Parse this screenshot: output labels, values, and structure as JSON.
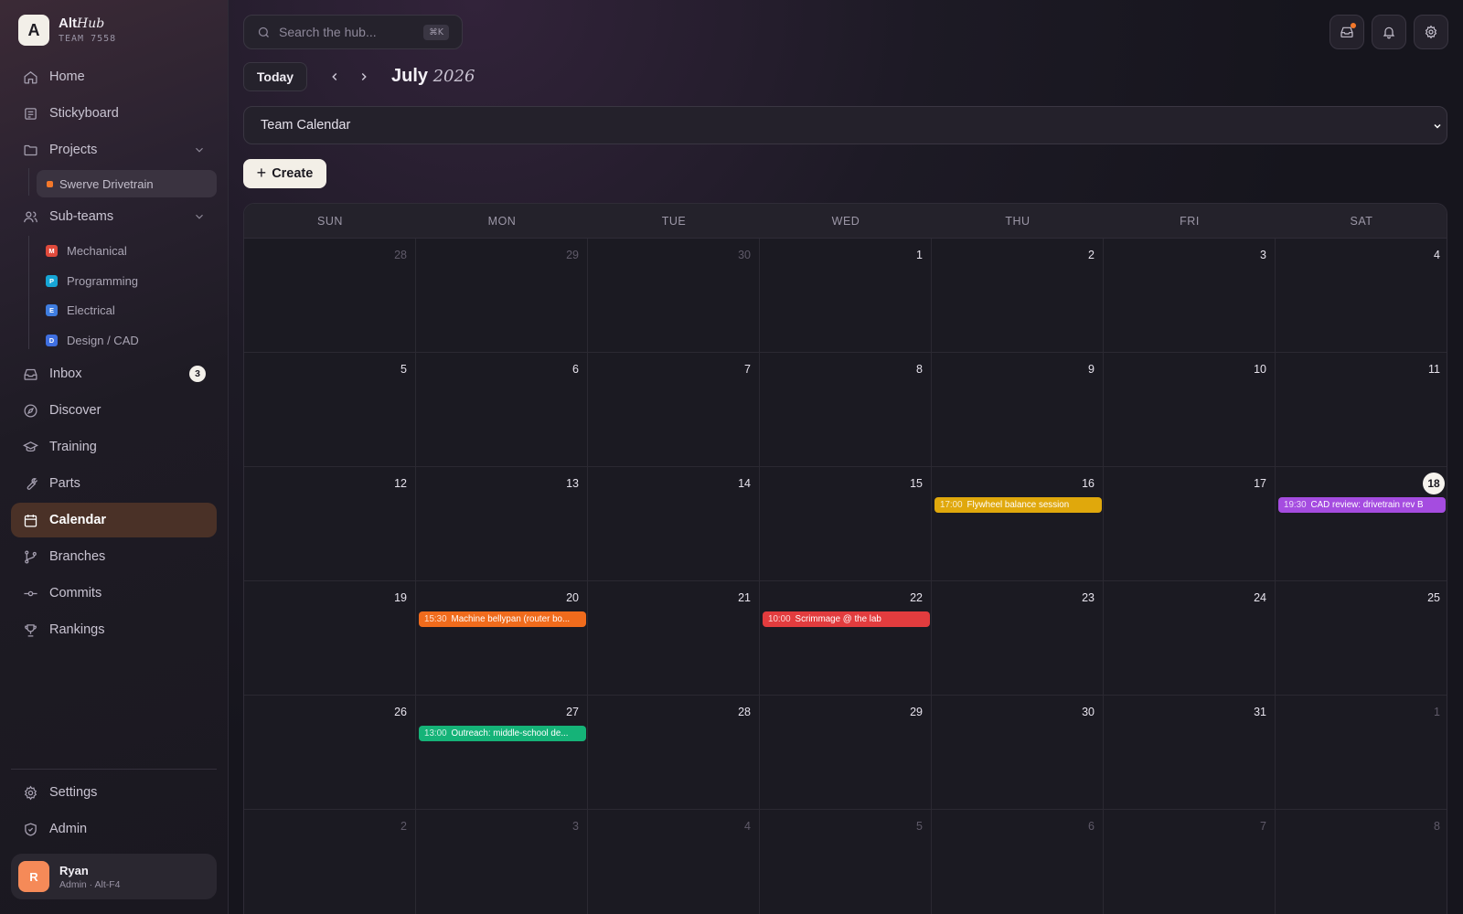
{
  "brand": {
    "name": "Alt",
    "name_italic": "Hub",
    "logo_letter": "A",
    "team": "TEAM 7558"
  },
  "nav": {
    "home": "Home",
    "stickyboard": "Stickyboard",
    "projects": "Projects",
    "project_items": [
      "Swerve Drivetrain"
    ],
    "subteams": "Sub-teams",
    "subteam_items": [
      {
        "label": "Mechanical",
        "letter": "M",
        "color": "#e04a3c"
      },
      {
        "label": "Programming",
        "letter": "P",
        "color": "#16a6d6"
      },
      {
        "label": "Electrical",
        "letter": "E",
        "color": "#3f7de0"
      },
      {
        "label": "Design / CAD",
        "letter": "D",
        "color": "#3f6fe0"
      }
    ],
    "inbox": "Inbox",
    "inbox_count": "3",
    "discover": "Discover",
    "training": "Training",
    "parts": "Parts",
    "calendar": "Calendar",
    "branches": "Branches",
    "commits": "Commits",
    "rankings": "Rankings",
    "settings": "Settings",
    "admin": "Admin"
  },
  "user": {
    "initial": "R",
    "name": "Ryan",
    "role": "Admin · Alt-F4"
  },
  "search": {
    "placeholder": "Search the hub...",
    "shortcut": "⌘K"
  },
  "toolbar": {
    "today": "Today",
    "month": "July",
    "year": "2026"
  },
  "calendar_select": {
    "value": "Team Calendar"
  },
  "create_label": "Create",
  "weekdays": [
    "SUN",
    "MON",
    "TUE",
    "WED",
    "THU",
    "FRI",
    "SAT"
  ],
  "weeks": [
    [
      {
        "d": "28",
        "muted": true
      },
      {
        "d": "29",
        "muted": true
      },
      {
        "d": "30",
        "muted": true
      },
      {
        "d": "1"
      },
      {
        "d": "2"
      },
      {
        "d": "3"
      },
      {
        "d": "4"
      }
    ],
    [
      {
        "d": "5"
      },
      {
        "d": "6"
      },
      {
        "d": "7"
      },
      {
        "d": "8"
      },
      {
        "d": "9"
      },
      {
        "d": "10"
      },
      {
        "d": "11"
      }
    ],
    [
      {
        "d": "12"
      },
      {
        "d": "13"
      },
      {
        "d": "14"
      },
      {
        "d": "15"
      },
      {
        "d": "16",
        "event": {
          "time": "17:00",
          "title": "Flywheel balance session",
          "color": "#e0a80c"
        }
      },
      {
        "d": "17"
      },
      {
        "d": "18",
        "today": true,
        "event": {
          "time": "19:30",
          "title": "CAD review: drivetrain rev B",
          "color": "#a54ce0"
        }
      }
    ],
    [
      {
        "d": "19"
      },
      {
        "d": "20",
        "event": {
          "time": "15:30",
          "title": "Machine bellypan (router bo...",
          "color": "#f06b1c"
        }
      },
      {
        "d": "21"
      },
      {
        "d": "22",
        "event": {
          "time": "10:00",
          "title": "Scrimmage @ the lab",
          "color": "#e23c3e"
        }
      },
      {
        "d": "23"
      },
      {
        "d": "24"
      },
      {
        "d": "25"
      }
    ],
    [
      {
        "d": "26"
      },
      {
        "d": "27",
        "event": {
          "time": "13:00",
          "title": "Outreach: middle-school de...",
          "color": "#15b378"
        }
      },
      {
        "d": "28"
      },
      {
        "d": "29"
      },
      {
        "d": "30"
      },
      {
        "d": "31"
      },
      {
        "d": "1",
        "muted": true
      }
    ],
    [
      {
        "d": "2",
        "muted": true
      },
      {
        "d": "3",
        "muted": true
      },
      {
        "d": "4",
        "muted": true
      },
      {
        "d": "5",
        "muted": true
      },
      {
        "d": "6",
        "muted": true
      },
      {
        "d": "7",
        "muted": true
      },
      {
        "d": "8",
        "muted": true
      }
    ]
  ]
}
